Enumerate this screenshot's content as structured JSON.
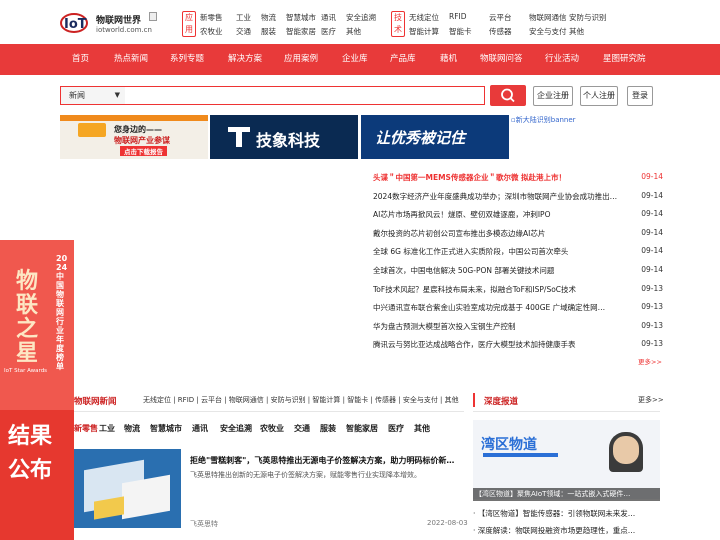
{
  "header": {
    "logo_text": "物联网世界",
    "logo_url": "iotworld.com.cn",
    "cat1_label": "应用",
    "cat2_label": "技术",
    "nav_app_row1": [
      "新零售",
      "工业",
      "物流",
      "智慧城市",
      "通讯",
      "安全追溯"
    ],
    "nav_app_row2": [
      "农牧业",
      "交通",
      "服装",
      "智能家居",
      "医疗",
      "其他"
    ],
    "nav_tech_row1": [
      "无线定位",
      "RFID",
      "云平台",
      "物联网通信",
      "安防与识别"
    ],
    "nav_tech_row2": [
      "智能计算",
      "智能卡",
      "传感器",
      "安全与支付",
      "其他"
    ]
  },
  "main_nav": [
    "首页",
    "热点新闻",
    "系列专题",
    "解决方案",
    "应用案例",
    "企业库",
    "产品库",
    "藉机",
    "物联网问答",
    "行业活动",
    "星图研究院"
  ],
  "search": {
    "category": "新闻",
    "register_enterprise": "企业注册",
    "register_personal": "个人注册",
    "login": "登录"
  },
  "banners": {
    "b1_line1": "您身边的——",
    "b1_line2": "物联网产业参谋",
    "b1_cta": "点击下载报告",
    "b2_text": "技象科技",
    "b3_text": "让优秀被记住",
    "b4_alt": "新大陆识别banner"
  },
  "news": [
    {
      "title": "头谍＂中国第一MEMS传感器企业＂歌尔微 拟赴港上市！",
      "date": "09-14",
      "highlight": true
    },
    {
      "title": "2024数字经济产业年度盛典成功举办；深圳市物联网产业协会成功推出…",
      "date": "09-14"
    },
    {
      "title": "AI芯片市场再掀风云！燧原、壁仞双雄逐鹿，冲刺IPO",
      "date": "09-14"
    },
    {
      "title": "戴尔投资的芯片初创公司宣布推出多模态边缘AI芯片",
      "date": "09-14"
    },
    {
      "title": "全球 6G 标准化工作正式进入实质阶段，中国公司首次牵头",
      "date": "09-14"
    },
    {
      "title": "全球首次，中国电信解决 50G-PON 部署关键技术问题",
      "date": "09-14"
    },
    {
      "title": "ToF技术风起？星宸科技布局未来，拟融合ToF和ISP/SoC技术",
      "date": "09-13"
    },
    {
      "title": "中兴通讯宣布联合紫金山实验室成功完成基于 400GE 广域确定性网…",
      "date": "09-13"
    },
    {
      "title": "华为盘古预测大模型首次投入宝钢生产控制",
      "date": "09-13"
    },
    {
      "title": "腾讯云与努比亚达成战略合作，医疗大模型技术加持健康手表",
      "date": "09-13"
    }
  ],
  "news_more": "更多>>",
  "left_ad": {
    "line1": "2024中国物联网行业年度榜单",
    "line2": "物联之星",
    "line3": "IoT Star Awards",
    "line4": "结果",
    "line5": "公布"
  },
  "iot_section": {
    "title": "物联网新闻",
    "links": "无线定位 | RFID | 云平台 | 物联网通信 | 安防与识别 | 智能计算 | 智能卡 | 传感器 | 安全与支付 | 其他",
    "tabs": [
      "新零售",
      "工业",
      "物流",
      "智慧城市",
      "通讯",
      "安全追溯",
      "农牧业",
      "交通",
      "服装",
      "智能家居",
      "医疗",
      "其他"
    ],
    "article": {
      "title": "拒绝\"雪糕刺客\"，飞英思特推出无源电子价签解决方案，助力明码标价新…",
      "desc": "飞英思特推出创新的无源电子价签解决方案，赋能零售行业实现降本增效。",
      "source": "飞英思特",
      "date": "2022-08-03"
    }
  },
  "depth": {
    "title": "深度报道",
    "more": "更多>>",
    "img_brand": "湾区物道",
    "caption": "【湾区物道】聚焦AIoT领域：一站式嵌入式硬件…",
    "items": [
      "· 【湾区物道】智能传感器：引领物联网未来发…",
      "· 深度解读：物联网投融资市场更趋理性，重点…"
    ]
  },
  "colors": {
    "brand_red": "#e83a3a",
    "highlight": "#e33"
  }
}
